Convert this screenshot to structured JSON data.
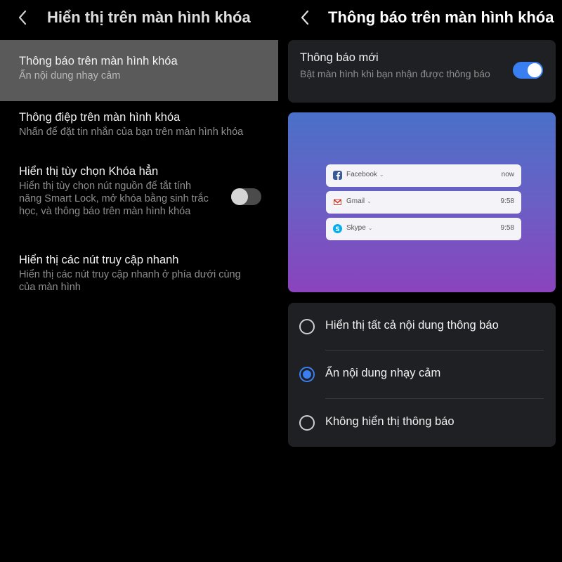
{
  "left": {
    "title": "Hiển thị trên màn hình khóa",
    "items": [
      {
        "title": "Thông báo trên màn hình khóa",
        "subtitle": "Ẩn nội dung nhạy cảm"
      },
      {
        "title": "Thông điệp trên màn hình khóa",
        "subtitle": "Nhấn để đặt tin nhắn của bạn trên màn hình khóa"
      },
      {
        "title": "Hiển thị tùy chọn Khóa hẳn",
        "subtitle": "Hiển thị tùy chọn nút nguồn để tắt tính năng Smart Lock, mở khóa bằng sinh trắc học, và thông báo trên màn hình khóa"
      },
      {
        "title": "Hiển thị các nút truy cập nhanh",
        "subtitle": "Hiển thị các nút truy cập nhanh ở phía dưới cùng của màn hình"
      }
    ]
  },
  "right": {
    "title": "Thông báo trên màn hình khóa",
    "new_notifications": {
      "title": "Thông báo mới",
      "subtitle": "Bật màn hình khi bạn nhận được thông báo"
    },
    "preview": [
      {
        "app": "Facebook",
        "time": "now",
        "icon": "facebook-icon",
        "color": "#3b5998"
      },
      {
        "app": "Gmail",
        "time": "9:58",
        "icon": "gmail-icon",
        "color": "#d93025"
      },
      {
        "app": "Skype",
        "time": "9:58",
        "icon": "skype-icon",
        "color": "#00aff0"
      }
    ],
    "options": [
      {
        "label": "Hiển thị tất cả nội dung thông báo",
        "checked": false
      },
      {
        "label": "Ẩn nội dung nhạy cảm",
        "checked": true
      },
      {
        "label": "Không hiển thị thông báo",
        "checked": false
      }
    ]
  },
  "colors": {
    "accent": "#3a7ff2",
    "selected_row": "#5a5a5a",
    "card": "#1f2024"
  }
}
